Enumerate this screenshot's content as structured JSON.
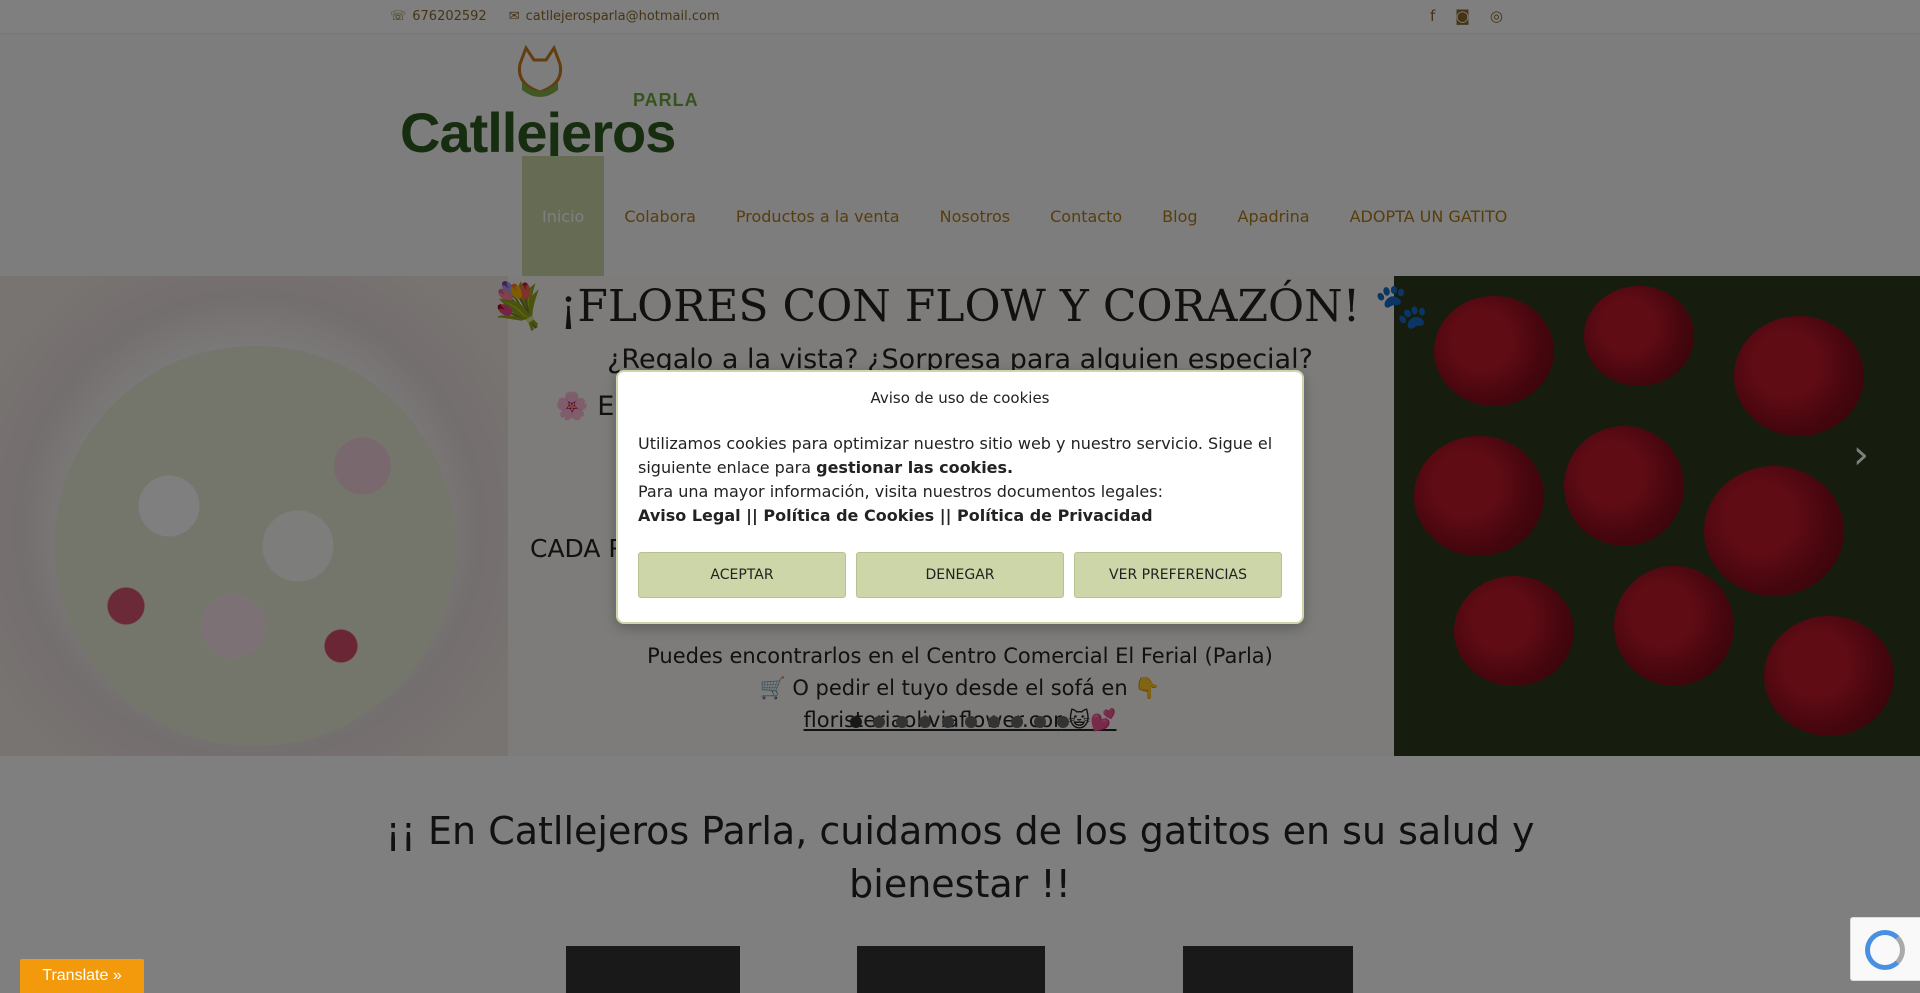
{
  "topbar": {
    "phone": "676202592",
    "email": "catllejerosparla@hotmail.com",
    "social": [
      "facebook-icon",
      "instagram-icon",
      "whatsapp-icon"
    ]
  },
  "logo": {
    "parla": "PARLA",
    "name": "Catllejeros"
  },
  "nav": {
    "items": [
      "Inicio",
      "Colabora",
      "Productos a la venta",
      "Nosotros",
      "Contacto",
      "Blog",
      "Apadrina",
      "ADOPTA UN GATITO"
    ],
    "active": "Inicio"
  },
  "slider": {
    "title": "¡FLORES CON FLOW Y CORAZÓN!",
    "subtitle": "¿Regalo a la vista? ¿Sorpresa para alguien especial?",
    "partial_en": "En",
    "partial_cada": "CADA R",
    "find": "Puedes encontrarlos en el Centro Comercial El Ferial (Parla)",
    "order": "O pedir el tuyo desde el sofá en",
    "link": "floristeriaoliviaflower.cor"
  },
  "section": {
    "title": "¡¡ En Catllejeros Parla, cuidamos de los gatitos en su salud y bienestar !!"
  },
  "cookie": {
    "title": "Aviso de uso de cookies",
    "text1": "Utilizamos cookies para optimizar nuestro sitio web y nuestro servicio. Sigue el siguiente enlace para",
    "manage_link": "gestionar las cookies.",
    "text2": "Para una mayor información, visita nuestros documentos legales:",
    "legal_links": "Aviso Legal || Política de Cookies || Política de Privacidad",
    "accept": "ACEPTAR",
    "deny": "DENEGAR",
    "preferences": "VER PREFERENCIAS"
  },
  "translate": {
    "label": "Translate »"
  },
  "colors": {
    "accent": "#cdd6a9",
    "nav_text": "#b07a1a",
    "translate_bg": "#f29a0c"
  }
}
